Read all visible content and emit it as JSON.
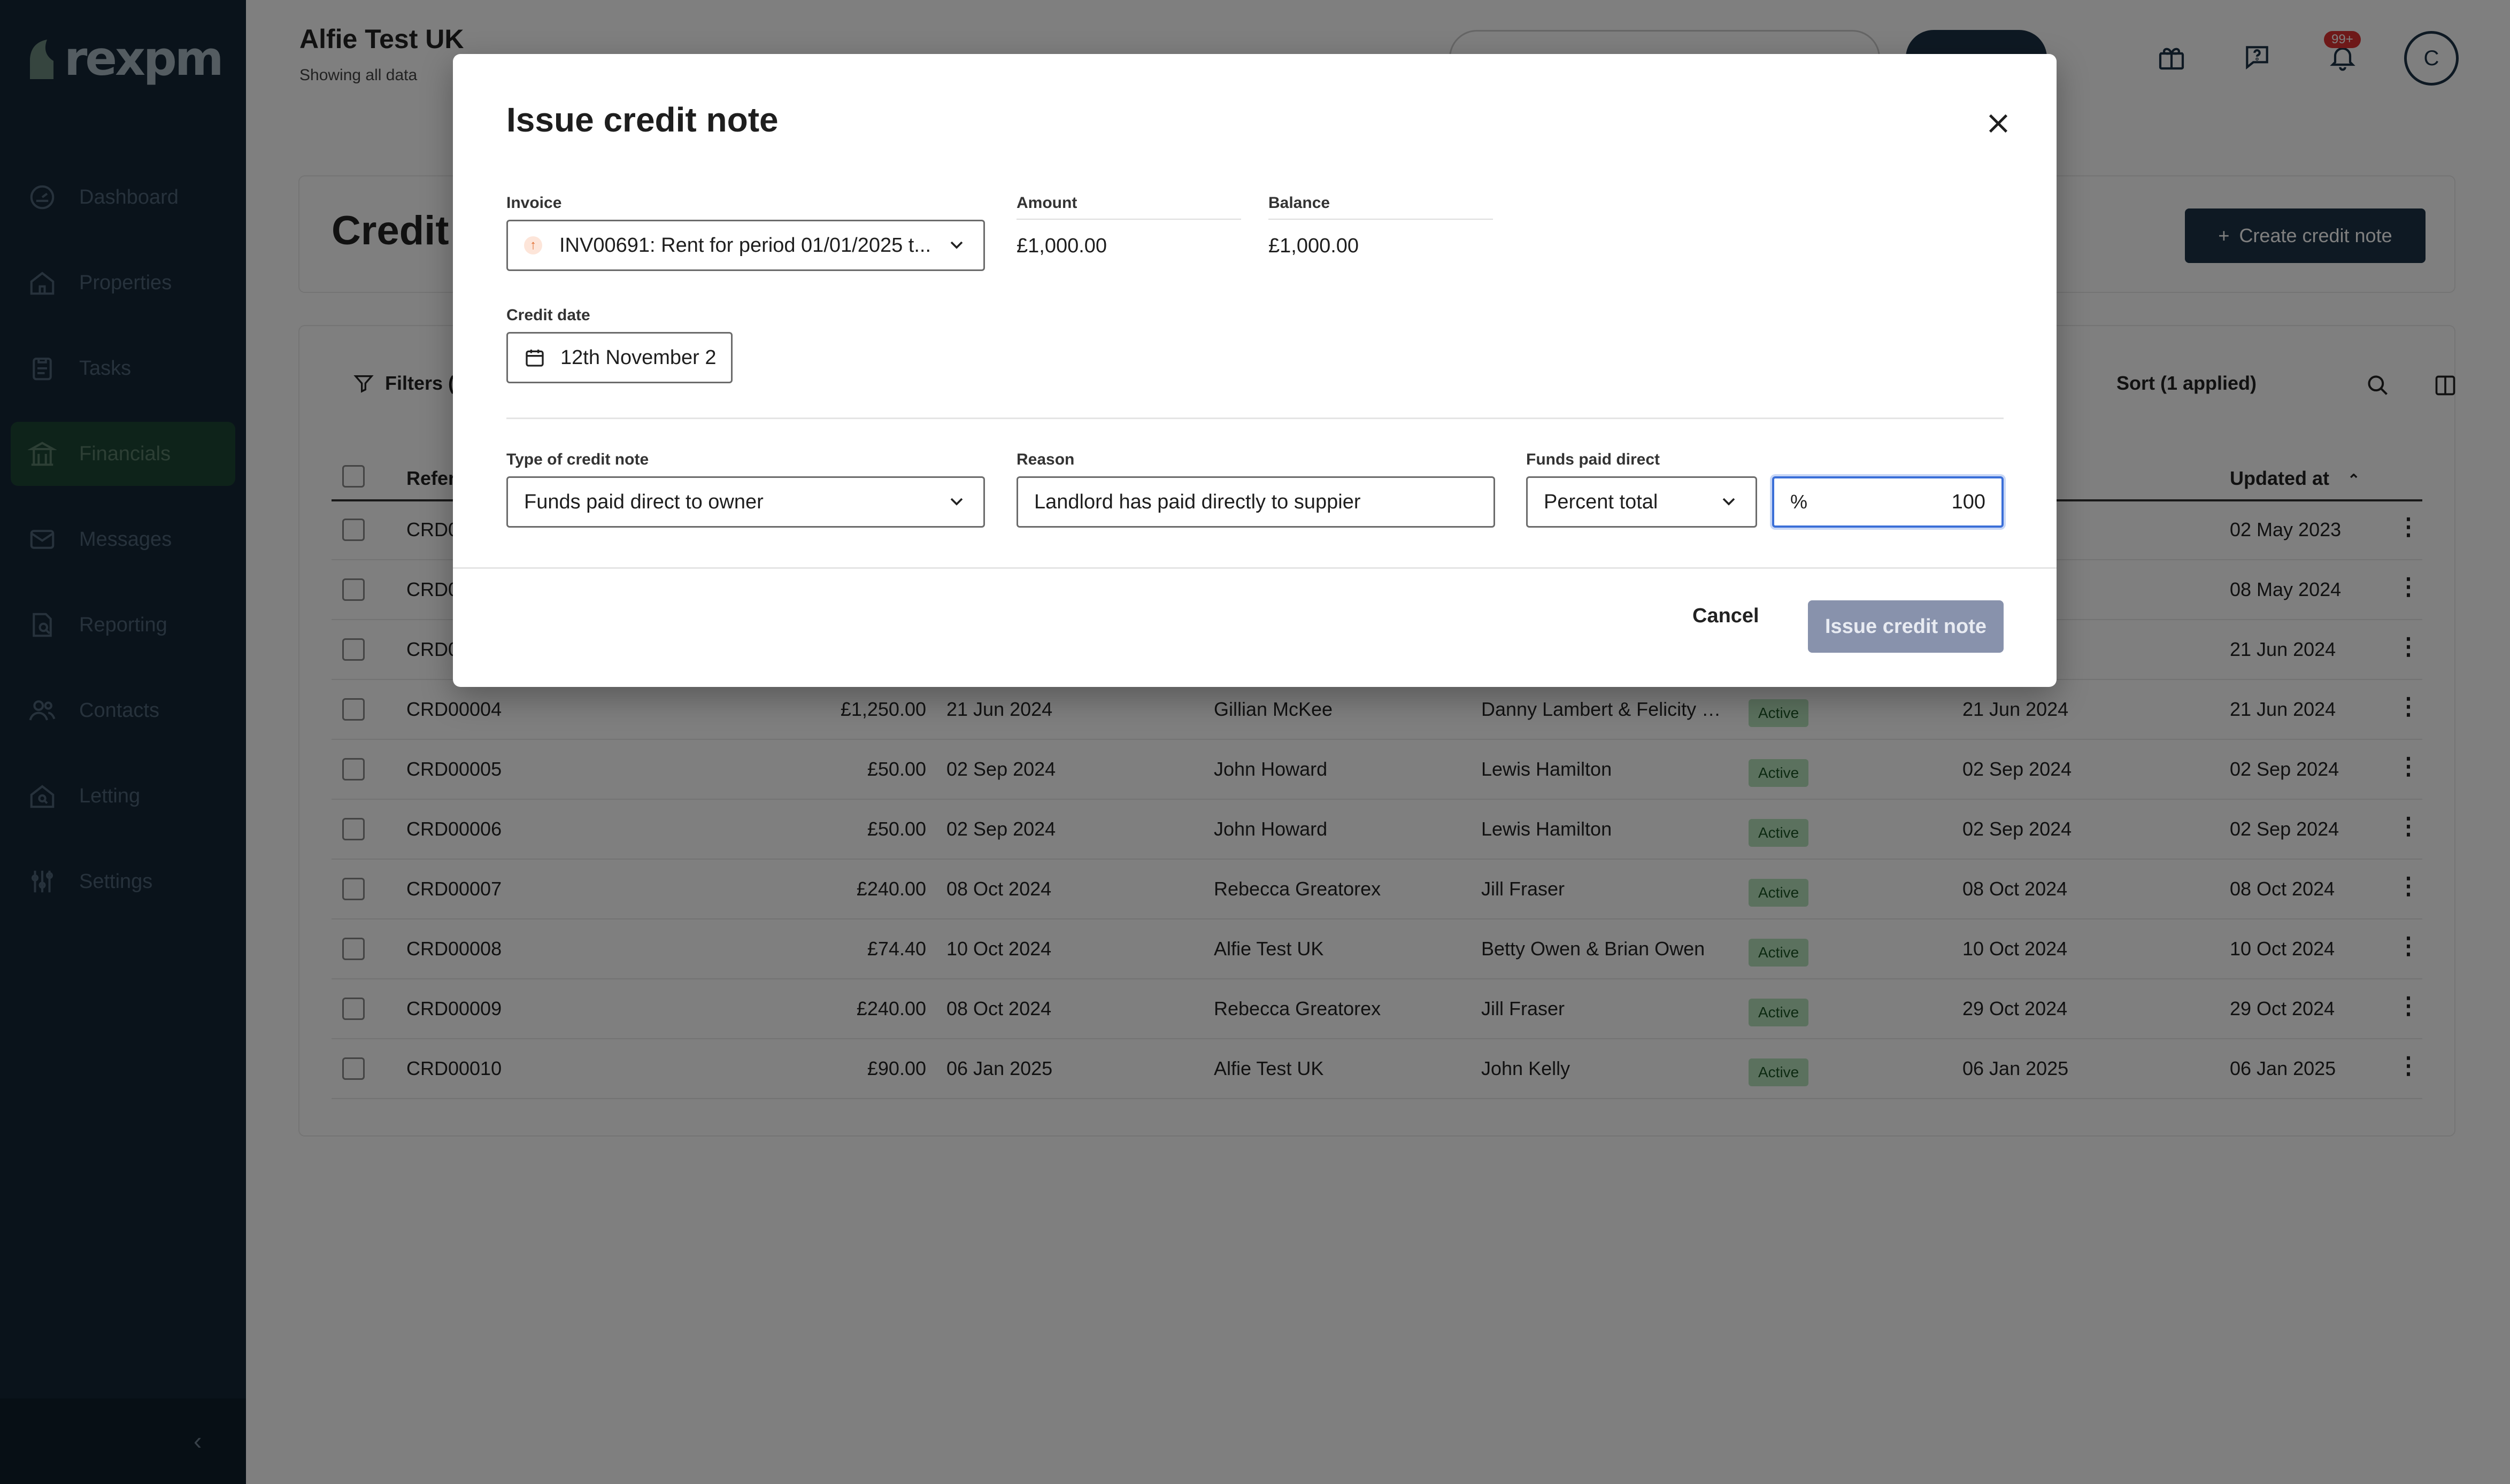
{
  "app": {
    "logo_text": "rexpm",
    "org_name": "Alfie Test UK",
    "org_sub": "Showing all data",
    "notifications_badge": "99+",
    "avatar_initial": "C"
  },
  "sidebar": {
    "items": [
      {
        "label": "Dashboard",
        "icon": "dashboard-icon"
      },
      {
        "label": "Properties",
        "icon": "home-icon"
      },
      {
        "label": "Tasks",
        "icon": "clipboard-icon"
      },
      {
        "label": "Financials",
        "icon": "bank-icon",
        "active": true
      },
      {
        "label": "Messages",
        "icon": "mail-icon"
      },
      {
        "label": "Reporting",
        "icon": "report-icon"
      },
      {
        "label": "Contacts",
        "icon": "users-icon"
      },
      {
        "label": "Letting",
        "icon": "house-search-icon"
      },
      {
        "label": "Settings",
        "icon": "sliders-icon"
      }
    ],
    "collapse_glyph": "‹"
  },
  "page": {
    "title": "Credit n",
    "create_button": "Create credit note",
    "filters_label": "Filters (",
    "sort_label": "Sort (1 applied)",
    "columns": {
      "reference": "Refer",
      "updated_at": "Updated at"
    }
  },
  "table": {
    "rows": [
      {
        "ref": "CRD0",
        "amount": "",
        "date": "",
        "created_by": "",
        "contact": "",
        "status": "",
        "created": "",
        "updated": "02 May 2023"
      },
      {
        "ref": "CRD0",
        "amount": "",
        "date": "",
        "created_by": "",
        "contact": "",
        "status": "",
        "created": "",
        "updated": "08 May 2024"
      },
      {
        "ref": "CRD0",
        "amount": "",
        "date": "",
        "created_by": "",
        "contact": "",
        "status": "",
        "created": "",
        "updated": "21 Jun 2024"
      },
      {
        "ref": "CRD00004",
        "amount": "£1,250.00",
        "date": "21 Jun 2024",
        "created_by": "Gillian McKee",
        "contact": "Danny Lambert & Felicity …",
        "status": "Active",
        "created": "21 Jun 2024",
        "updated": "21 Jun 2024"
      },
      {
        "ref": "CRD00005",
        "amount": "£50.00",
        "date": "02 Sep 2024",
        "created_by": "John Howard",
        "contact": "Lewis Hamilton",
        "status": "Active",
        "created": "02 Sep 2024",
        "updated": "02 Sep 2024"
      },
      {
        "ref": "CRD00006",
        "amount": "£50.00",
        "date": "02 Sep 2024",
        "created_by": "John Howard",
        "contact": "Lewis Hamilton",
        "status": "Active",
        "created": "02 Sep 2024",
        "updated": "02 Sep 2024"
      },
      {
        "ref": "CRD00007",
        "amount": "£240.00",
        "date": "08 Oct 2024",
        "created_by": "Rebecca Greatorex",
        "contact": "Jill Fraser",
        "status": "Active",
        "created": "08 Oct 2024",
        "updated": "08 Oct 2024"
      },
      {
        "ref": "CRD00008",
        "amount": "£74.40",
        "date": "10 Oct 2024",
        "created_by": "Alfie Test UK",
        "contact": "Betty Owen & Brian Owen",
        "status": "Active",
        "created": "10 Oct 2024",
        "updated": "10 Oct 2024"
      },
      {
        "ref": "CRD00009",
        "amount": "£240.00",
        "date": "08 Oct 2024",
        "created_by": "Rebecca Greatorex",
        "contact": "Jill Fraser",
        "status": "Active",
        "created": "29 Oct 2024",
        "updated": "29 Oct 2024"
      },
      {
        "ref": "CRD00010",
        "amount": "£90.00",
        "date": "06 Jan 2025",
        "created_by": "Alfie Test UK",
        "contact": "John Kelly",
        "status": "Active",
        "created": "06 Jan 2025",
        "updated": "06 Jan 2025"
      }
    ]
  },
  "modal": {
    "title": "Issue credit note",
    "invoice_label": "Invoice",
    "invoice_value": "INV00691: Rent for period 01/01/2025 t...",
    "amount_label": "Amount",
    "amount_value": "£1,000.00",
    "balance_label": "Balance",
    "balance_value": "£1,000.00",
    "credit_date_label": "Credit date",
    "credit_date_value": "12th November 2",
    "type_label": "Type of credit note",
    "type_value": "Funds paid direct to owner",
    "reason_label": "Reason",
    "reason_value": "Landlord has paid directly to suppier",
    "funds_label": "Funds paid direct",
    "funds_mode_value": "Percent total",
    "percent_symbol": "%",
    "percent_value": "100",
    "cancel_label": "Cancel",
    "issue_label": "Issue credit note"
  }
}
